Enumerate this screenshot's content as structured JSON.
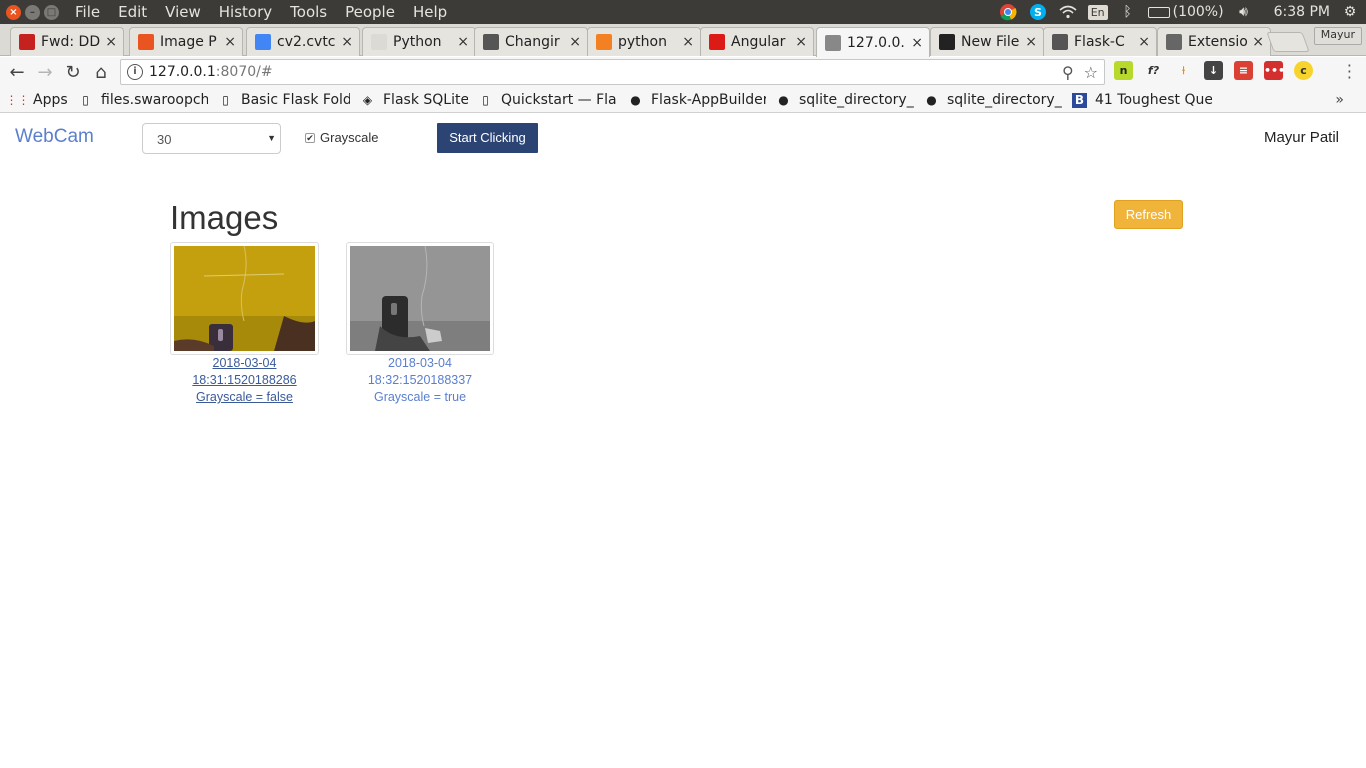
{
  "os": {
    "menus": [
      "File",
      "Edit",
      "View",
      "History",
      "Tools",
      "People",
      "Help"
    ],
    "battery": "(100%)",
    "clock": "6:38 PM",
    "keyboard": "En"
  },
  "tabs": [
    {
      "title": "Fwd: DD",
      "icon": "gmail-icon",
      "color": "#c5221f"
    },
    {
      "title": "Image P",
      "icon": "image-icon",
      "color": "#e95420"
    },
    {
      "title": "cv2.cvtc",
      "icon": "google-icon",
      "color": "#4285f4"
    },
    {
      "title": "Python",
      "icon": "python-icon",
      "color": "#dcdad5"
    },
    {
      "title": "Changir",
      "icon": "doc-icon",
      "color": "#555555"
    },
    {
      "title": "python",
      "icon": "stackoverflow-icon",
      "color": "#f48024"
    },
    {
      "title": "Angular",
      "icon": "angular-icon",
      "color": "#dd1b16"
    },
    {
      "title": "127.0.0.",
      "icon": "page-icon",
      "color": "#888888",
      "active": true
    },
    {
      "title": "New File",
      "icon": "github-icon",
      "color": "#222222"
    },
    {
      "title": "Flask-C",
      "icon": "doc-icon",
      "color": "#555555"
    },
    {
      "title": "Extensio",
      "icon": "puzzle-icon",
      "color": "#666666"
    }
  ],
  "profile": "Mayur",
  "address": {
    "host": "127.0.0.1",
    "rest": ":8070/#"
  },
  "bookmarks": [
    {
      "label": "Apps",
      "icon": "apps-grid-icon"
    },
    {
      "label": "files.swaroopch",
      "icon": "page-icon"
    },
    {
      "label": "Basic Flask Folde",
      "icon": "page-icon"
    },
    {
      "label": "Flask SQLite",
      "icon": "diamond-icon"
    },
    {
      "label": "Quickstart — Fla",
      "icon": "page-icon"
    },
    {
      "label": "Flask-AppBuilder",
      "icon": "github-icon"
    },
    {
      "label": "sqlite_directory_",
      "icon": "github-icon"
    },
    {
      "label": "sqlite_directory_",
      "icon": "github-icon"
    },
    {
      "label": "41 Toughest Que",
      "icon": "b-icon"
    }
  ],
  "app": {
    "brand": "WebCam",
    "interval": "30",
    "grayscale_label": "Grayscale",
    "grayscale_checked": true,
    "start_label": "Start Clicking",
    "user": "Mayur Patil",
    "heading": "Images",
    "refresh_label": "Refresh",
    "images": [
      {
        "line1": "2018-03-04",
        "line2": "18:31:1520188286",
        "line3": "Grayscale = false",
        "grayscale": false
      },
      {
        "line1": "2018-03-04",
        "line2": "18:32:1520188337",
        "line3": "Grayscale = true",
        "grayscale": true
      }
    ]
  }
}
